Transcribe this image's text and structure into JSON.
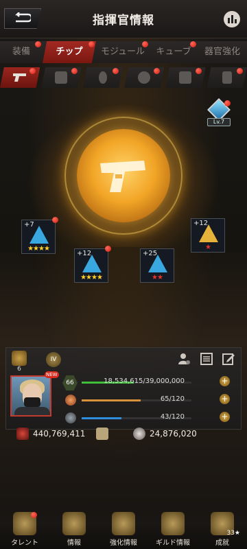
{
  "header": {
    "title": "指揮官情報"
  },
  "tabs": [
    {
      "label": "装備",
      "active": false
    },
    {
      "label": "チップ",
      "active": true
    },
    {
      "label": "モジュール",
      "active": false
    },
    {
      "label": "キューブ",
      "active": false
    },
    {
      "label": "器官強化",
      "active": false
    }
  ],
  "subtabs": [
    {
      "icon": "pistol-icon",
      "active": true
    },
    {
      "icon": "armor-icon",
      "active": false
    },
    {
      "icon": "bullet-icon",
      "active": false
    },
    {
      "icon": "gasmask-icon",
      "active": false
    },
    {
      "icon": "vest-icon",
      "active": false
    },
    {
      "icon": "boot-icon",
      "active": false
    }
  ],
  "core": {
    "icon": "pistol-icon",
    "level_badge": "Lv.7"
  },
  "chips": [
    {
      "plus": "+7",
      "stars": "★★★★"
    },
    {
      "plus": "+12",
      "stars": "★★★★"
    },
    {
      "plus": "+25",
      "stars": "★★"
    },
    {
      "plus": "+12",
      "stars": "★"
    }
  ],
  "panel": {
    "rank_number": "6",
    "tier_label": "IV",
    "new_label": "NEW",
    "level": "66",
    "stats": [
      {
        "text": "18,534,615/39,000,000",
        "fill": 0.475,
        "color": "#3fbf3a"
      },
      {
        "text": "65/120",
        "fill": 0.54,
        "color": "#d9913a"
      },
      {
        "text": "43/120",
        "fill": 0.36,
        "color": "#2c8fe0"
      }
    ],
    "power_left": "440,769,411",
    "power_right": "24,876,020"
  },
  "bottom_nav": [
    {
      "label": "タレント"
    },
    {
      "label": "情報"
    },
    {
      "label": "強化情報"
    },
    {
      "label": "ギルド情報"
    },
    {
      "label": "成就",
      "count": "33★"
    }
  ]
}
